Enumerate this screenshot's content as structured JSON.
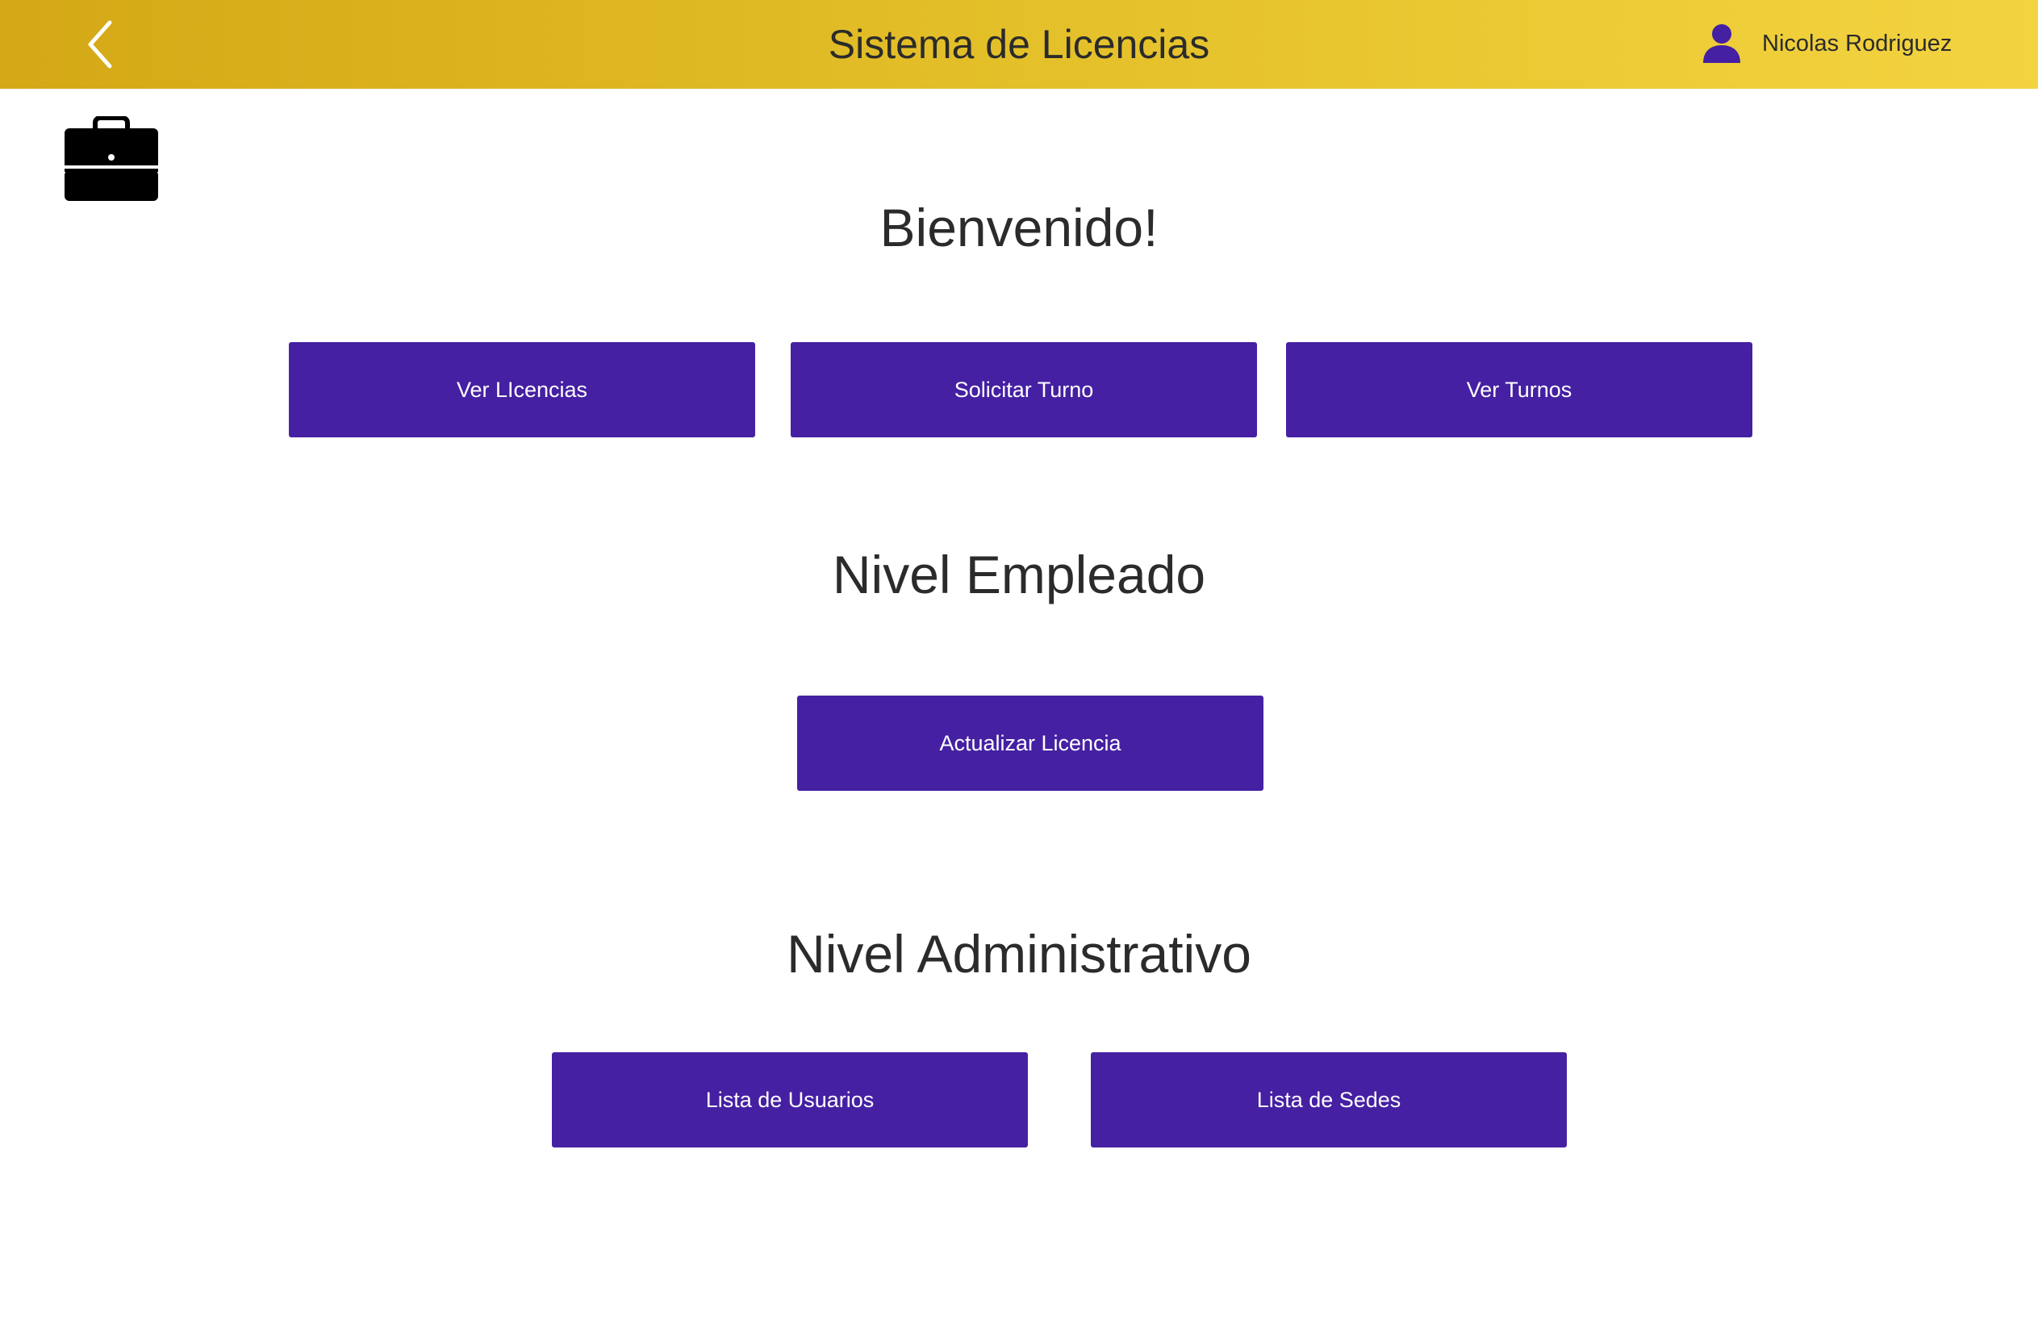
{
  "header": {
    "title": "Sistema de Licencias",
    "back_icon": "chevron-left-icon",
    "user_icon": "user-icon",
    "user_name": "Nicolas Rodriguez",
    "colors": {
      "gradient_start": "#d4a816",
      "gradient_end": "#f3d340",
      "user_icon": "#4520a2"
    }
  },
  "logo": {
    "icon": "briefcase-icon"
  },
  "main": {
    "welcome_title": "Bienvenido!",
    "general_buttons": [
      {
        "label": "Ver LIcencias"
      },
      {
        "label": "Solicitar Turno"
      },
      {
        "label": "Ver Turnos"
      }
    ],
    "employee_section": {
      "title": "Nivel Empleado",
      "buttons": [
        {
          "label": "Actualizar Licencia"
        }
      ]
    },
    "admin_section": {
      "title": "Nivel Administrativo",
      "buttons": [
        {
          "label": "Lista de Usuarios"
        },
        {
          "label": "Lista de Sedes"
        }
      ]
    }
  },
  "colors": {
    "button_bg": "#4520a2",
    "button_text": "#ffffff",
    "heading_text": "#2b2b2b"
  }
}
